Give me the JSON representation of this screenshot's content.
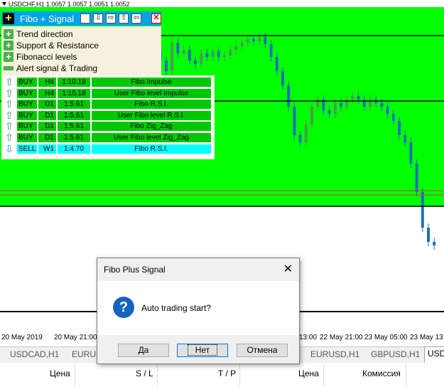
{
  "chart": {
    "symbol_info": "USDCHF,H1  1.0057 1.0057 1.0051 1.0052",
    "colors": {
      "zone": "#00ff00",
      "bull": "#4a9e4a",
      "bear": "#1e6fb8",
      "level": "#000000",
      "redline": "#d04040"
    },
    "x_axis_labels": [
      "20 May 2019",
      "20 May 21:00",
      "13:00",
      "22 May 21:00",
      "23 May 05:00",
      "23 May 13"
    ]
  },
  "panel": {
    "title": "Fibo + Signal",
    "plus_icon": "+",
    "toolbar_icons": [
      "blank-icon",
      "arrow-down-icon",
      "arrow-right-icon",
      "arrow-up-icon",
      "arrow-left-icon",
      "close-icon"
    ],
    "toolbar_glyphs": [
      "",
      "⇩",
      "⇨",
      "⇧",
      "⇦",
      "✕"
    ],
    "menu": [
      {
        "label": "Trend direction",
        "icon": "plus"
      },
      {
        "label": "Support & Resistance",
        "icon": "plus"
      },
      {
        "label": "Fibonacci levels",
        "icon": "plus"
      },
      {
        "label": "Alert signal & Trading",
        "icon": "minus"
      }
    ],
    "signals": [
      {
        "dir": "BUY",
        "tf": "H4",
        "ratio": "1:10.18",
        "source": "Fibo  Impulse",
        "type": "buy"
      },
      {
        "dir": "BUY",
        "tf": "H4",
        "ratio": "1:10.18",
        "source": "User Fibo level  Impulse",
        "type": "buy"
      },
      {
        "dir": "BUY",
        "tf": "D1",
        "ratio": "1:5.61",
        "source": "Fibo  R.S.I.",
        "type": "buy"
      },
      {
        "dir": "BUY",
        "tf": "D1",
        "ratio": "1:5.61",
        "source": "User Fibo level  R.S.I.",
        "type": "buy"
      },
      {
        "dir": "BUY",
        "tf": "D1",
        "ratio": "1:5.61",
        "source": "Fibo  Zig_Zag",
        "type": "buy"
      },
      {
        "dir": "BUY",
        "tf": "D1",
        "ratio": "1:5.61",
        "source": "User Fibo level  Zig_Zag",
        "type": "buy"
      },
      {
        "dir": "SELL",
        "tf": "W1",
        "ratio": "1:4.70",
        "source": "Fibo  R.S.I.",
        "type": "sell"
      }
    ]
  },
  "tabs": [
    "USDCAD,H1",
    "EURUS",
    "EURUSD,H1",
    "GBPUSD,H1",
    "USD"
  ],
  "terminal": {
    "columns": [
      "Цена",
      "S / L",
      "T / P",
      "Цена",
      "Комиссия"
    ]
  },
  "dialog": {
    "title": "Fibo Plus Signal",
    "close_glyph": "✕",
    "icon_glyph": "?",
    "message": "Auto trading start?",
    "buttons": [
      "Да",
      "Нет",
      "Отмена"
    ]
  }
}
